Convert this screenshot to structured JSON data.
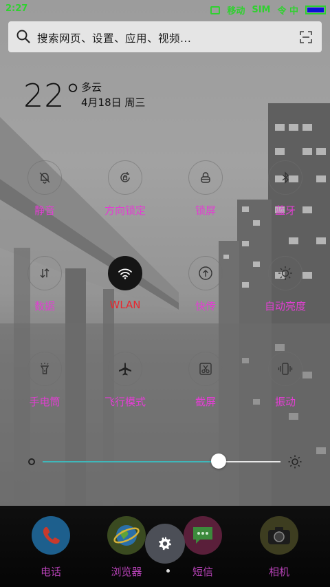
{
  "status_bar": {
    "time": "2:27",
    "network_label": "移动",
    "sim_label": "SIM",
    "extra_label": "令 中"
  },
  "search": {
    "placeholder": "搜索网页、设置、应用、视频..."
  },
  "weather": {
    "temperature": "22°",
    "condition": "多云",
    "date": "4月18日 周三"
  },
  "toggles": [
    {
      "label": "静音",
      "icon": "bell-off-icon",
      "on": false
    },
    {
      "label": "方向锁定",
      "icon": "rotation-lock-icon",
      "on": false
    },
    {
      "label": "锁屏",
      "icon": "lock-icon",
      "on": false
    },
    {
      "label": "蓝牙",
      "icon": "bluetooth-icon",
      "on": false
    },
    {
      "label": "数据",
      "icon": "data-arrows-icon",
      "on": false
    },
    {
      "label": "WLAN",
      "icon": "wifi-icon",
      "on": true
    },
    {
      "label": "快传",
      "icon": "upload-icon",
      "on": false
    },
    {
      "label": "自动亮度",
      "icon": "sun-icon",
      "on": false
    },
    {
      "label": "手电筒",
      "icon": "flashlight-icon",
      "on": false
    },
    {
      "label": "飞行模式",
      "icon": "airplane-icon",
      "on": false
    },
    {
      "label": "截屏",
      "icon": "scissors-icon",
      "on": false
    },
    {
      "label": "振动",
      "icon": "vibrate-icon",
      "on": false
    }
  ],
  "brightness": {
    "level_percent": 74,
    "accent": "#3fb7ba"
  },
  "dock": {
    "apps": [
      {
        "label": "电话",
        "icon": "phone-icon"
      },
      {
        "label": "浏览器",
        "icon": "browser-icon"
      },
      {
        "label": "短信",
        "icon": "message-icon"
      },
      {
        "label": "相机",
        "icon": "camera-icon"
      }
    ],
    "center_icon": "gear-icon"
  },
  "colors": {
    "label_pink": "#e13fd2",
    "label_active": "#e8272f",
    "status_green": "#2fd12f",
    "battery_blue": "#0a10d8"
  }
}
